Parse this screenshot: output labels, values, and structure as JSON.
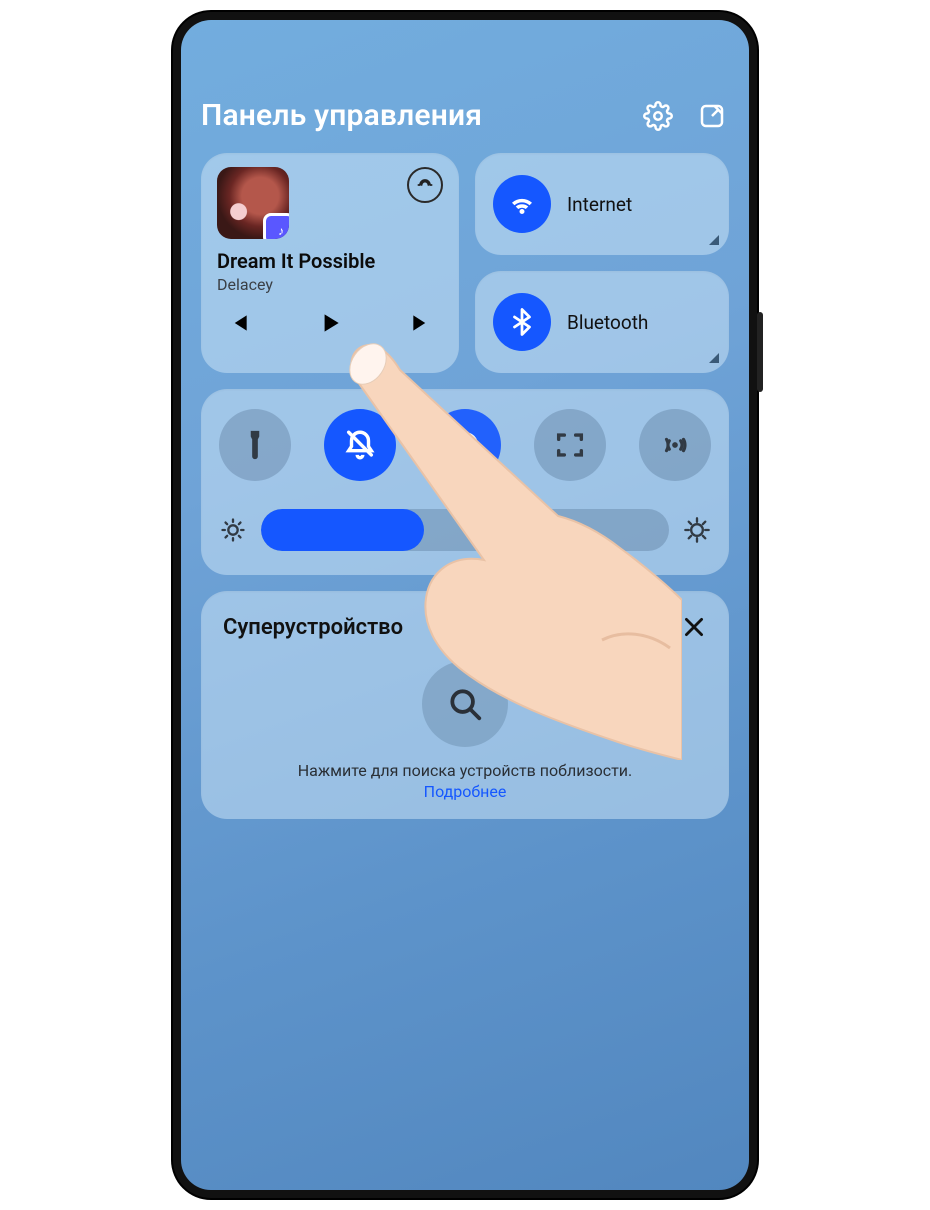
{
  "header": {
    "title": "Панель управления"
  },
  "music": {
    "track": "Dream It Possible",
    "artist": "Delacey"
  },
  "connectivity": {
    "wifi": "Internet",
    "bluetooth": "Bluetooth"
  },
  "brightness": {
    "percent": 40
  },
  "super": {
    "title": "Суперустройство",
    "hint": "Нажмите для поиска устройств поблизости.",
    "more": "Подробнее"
  }
}
